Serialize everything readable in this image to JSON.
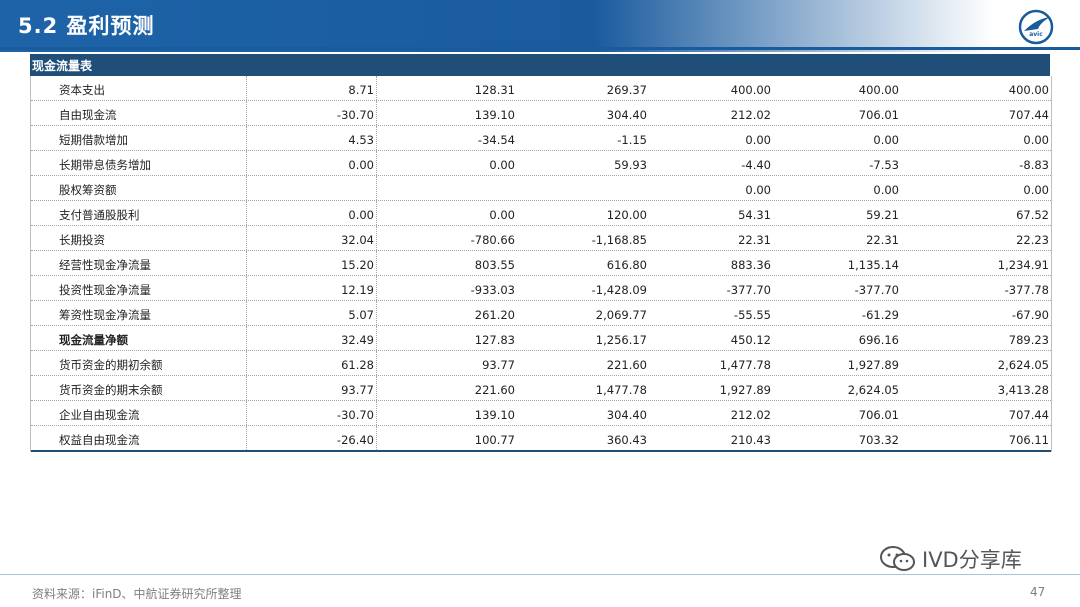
{
  "header": {
    "title": "5.2 盈利预测",
    "logo_text": "avic"
  },
  "table": {
    "section_title": "现金流量表",
    "rows": [
      {
        "label": "资本支出",
        "values": [
          "8.71",
          "128.31",
          "269.37",
          "400.00",
          "400.00",
          "400.00"
        ],
        "bold": false
      },
      {
        "label": "自由现金流",
        "values": [
          "-30.70",
          "139.10",
          "304.40",
          "212.02",
          "706.01",
          "707.44"
        ],
        "bold": false
      },
      {
        "label": "短期借款增加",
        "values": [
          "4.53",
          "-34.54",
          "-1.15",
          "0.00",
          "0.00",
          "0.00"
        ],
        "bold": false
      },
      {
        "label": "长期带息债务增加",
        "values": [
          "0.00",
          "0.00",
          "59.93",
          "-4.40",
          "-7.53",
          "-8.83"
        ],
        "bold": false
      },
      {
        "label": "股权筹资额",
        "values": [
          "",
          "",
          "",
          "0.00",
          "0.00",
          "0.00"
        ],
        "bold": false
      },
      {
        "label": "支付普通股股利",
        "values": [
          "0.00",
          "0.00",
          "120.00",
          "54.31",
          "59.21",
          "67.52"
        ],
        "bold": false
      },
      {
        "label": "长期投资",
        "values": [
          "32.04",
          "-780.66",
          "-1,168.85",
          "22.31",
          "22.31",
          "22.23"
        ],
        "bold": false
      },
      {
        "label": "经营性现金净流量",
        "values": [
          "15.20",
          "803.55",
          "616.80",
          "883.36",
          "1,135.14",
          "1,234.91"
        ],
        "bold": false
      },
      {
        "label": "投资性现金净流量",
        "values": [
          "12.19",
          "-933.03",
          "-1,428.09",
          "-377.70",
          "-377.70",
          "-377.78"
        ],
        "bold": false
      },
      {
        "label": "筹资性现金净流量",
        "values": [
          "5.07",
          "261.20",
          "2,069.77",
          "-55.55",
          "-61.29",
          "-67.90"
        ],
        "bold": false
      },
      {
        "label": "现金流量净额",
        "values": [
          "32.49",
          "127.83",
          "1,256.17",
          "450.12",
          "696.16",
          "789.23"
        ],
        "bold": true
      },
      {
        "label": "货币资金的期初余额",
        "values": [
          "61.28",
          "93.77",
          "221.60",
          "1,477.78",
          "1,927.89",
          "2,624.05"
        ],
        "bold": false
      },
      {
        "label": "货币资金的期末余额",
        "values": [
          "93.77",
          "221.60",
          "1,477.78",
          "1,927.89",
          "2,624.05",
          "3,413.28"
        ],
        "bold": false
      },
      {
        "label": "企业自由现金流",
        "values": [
          "-30.70",
          "139.10",
          "304.40",
          "212.02",
          "706.01",
          "707.44"
        ],
        "bold": false
      },
      {
        "label": "权益自由现金流",
        "values": [
          "-26.40",
          "100.77",
          "360.43",
          "210.43",
          "703.32",
          "706.11"
        ],
        "bold": false
      }
    ]
  },
  "footer": {
    "source": "资料来源：iFinD、中航证券研究所整理",
    "page_number": "47",
    "watermark_text": "IVD分享库"
  },
  "colors": {
    "title_bar": "#1a5b9e",
    "table_header": "#1f4e79"
  }
}
